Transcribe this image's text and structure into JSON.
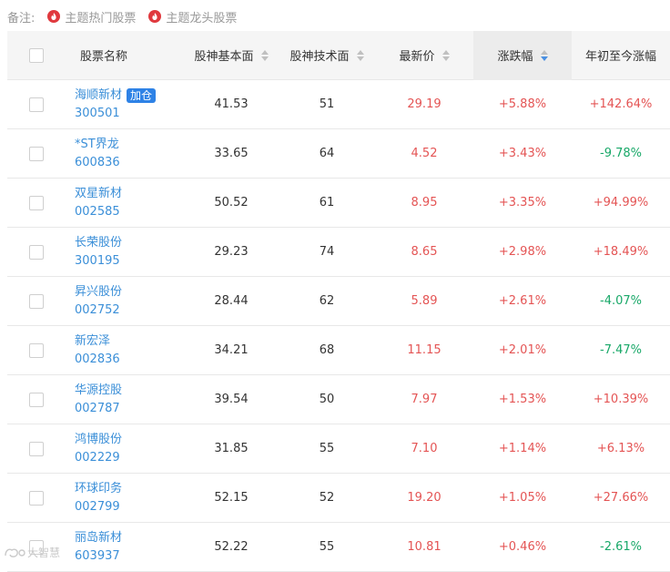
{
  "legend": {
    "label": "备注:",
    "items": [
      {
        "text": "主题热门股票",
        "icon": "flame-icon"
      },
      {
        "text": "主题龙头股票",
        "icon": "flame-icon"
      }
    ]
  },
  "colors": {
    "up": "#e45454",
    "down": "#18a868",
    "link": "#3b8fd8",
    "badge": "#2e82e6"
  },
  "table": {
    "headers": {
      "name": "股票名称",
      "fundamental": "股神基本面",
      "technical": "股神技术面",
      "price": "最新价",
      "change": "涨跌幅",
      "ytd": "年初至今涨幅"
    },
    "sorted_column": "change",
    "sort_order": "descending",
    "rows": [
      {
        "name": "海顺新材",
        "code": "300501",
        "badge": "加仓",
        "fundamental": "41.53",
        "technical": "51",
        "price": "29.19",
        "change": "+5.88%",
        "ytd": "+142.64%"
      },
      {
        "name": "*ST界龙",
        "code": "600836",
        "badge": "",
        "fundamental": "33.65",
        "technical": "64",
        "price": "4.52",
        "change": "+3.43%",
        "ytd": "-9.78%"
      },
      {
        "name": "双星新材",
        "code": "002585",
        "badge": "",
        "fundamental": "50.52",
        "technical": "61",
        "price": "8.95",
        "change": "+3.35%",
        "ytd": "+94.99%"
      },
      {
        "name": "长荣股份",
        "code": "300195",
        "badge": "",
        "fundamental": "29.23",
        "technical": "74",
        "price": "8.65",
        "change": "+2.98%",
        "ytd": "+18.49%"
      },
      {
        "name": "昇兴股份",
        "code": "002752",
        "badge": "",
        "fundamental": "28.44",
        "technical": "62",
        "price": "5.89",
        "change": "+2.61%",
        "ytd": "-4.07%"
      },
      {
        "name": "新宏泽",
        "code": "002836",
        "badge": "",
        "fundamental": "34.21",
        "technical": "68",
        "price": "11.15",
        "change": "+2.01%",
        "ytd": "-7.47%"
      },
      {
        "name": "华源控股",
        "code": "002787",
        "badge": "",
        "fundamental": "39.54",
        "technical": "50",
        "price": "7.97",
        "change": "+1.53%",
        "ytd": "+10.39%"
      },
      {
        "name": "鸿博股份",
        "code": "002229",
        "badge": "",
        "fundamental": "31.85",
        "technical": "55",
        "price": "7.10",
        "change": "+1.14%",
        "ytd": "+6.13%"
      },
      {
        "name": "环球印务",
        "code": "002799",
        "badge": "",
        "fundamental": "52.15",
        "technical": "52",
        "price": "19.20",
        "change": "+1.05%",
        "ytd": "+27.66%"
      },
      {
        "name": "丽岛新材",
        "code": "603937",
        "badge": "",
        "fundamental": "52.22",
        "technical": "55",
        "price": "10.81",
        "change": "+0.46%",
        "ytd": "-2.61%"
      }
    ]
  },
  "watermark": "大智慧"
}
